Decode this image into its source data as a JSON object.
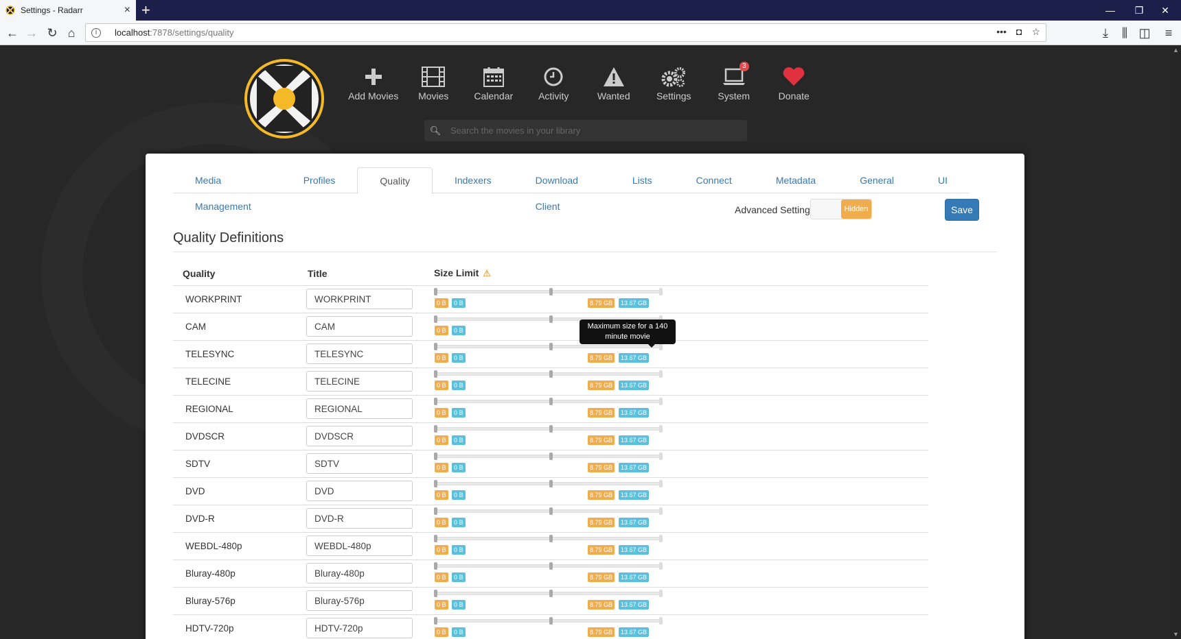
{
  "browser": {
    "tab_title": "Settings - Radarr",
    "url_host": "localhost",
    "url_rest": ":7878/settings/quality"
  },
  "nav": [
    {
      "label": "Add Movies",
      "icon": "plus-icon"
    },
    {
      "label": "Movies",
      "icon": "film-icon"
    },
    {
      "label": "Calendar",
      "icon": "calendar-icon"
    },
    {
      "label": "Activity",
      "icon": "clock-icon"
    },
    {
      "label": "Wanted",
      "icon": "warning-icon"
    },
    {
      "label": "Settings",
      "icon": "gears-icon"
    },
    {
      "label": "System",
      "icon": "laptop-icon",
      "badge": "3"
    },
    {
      "label": "Donate",
      "icon": "heart-icon"
    }
  ],
  "search": {
    "placeholder": "Search the movies in your library"
  },
  "settings_tabs": [
    "Media Management",
    "Profiles",
    "Quality",
    "Indexers",
    "Download Client",
    "Lists",
    "Connect",
    "Metadata",
    "General",
    "UI"
  ],
  "active_tab": "Quality",
  "advanced": {
    "label": "Advanced Settings",
    "state": "Hidden"
  },
  "save_label": "Save",
  "section_title": "Quality Definitions",
  "table": {
    "headers": {
      "quality": "Quality",
      "title": "Title",
      "size_limit": "Size Limit"
    },
    "size_labels": {
      "min_a": "0 B",
      "min_b": "0 B",
      "max_a": "8.79 GB",
      "max_b": "13.67 GB"
    },
    "rows": [
      {
        "quality": "WORKPRINT",
        "title": "WORKPRINT",
        "show_max": true
      },
      {
        "quality": "CAM",
        "title": "CAM",
        "show_max": false
      },
      {
        "quality": "TELESYNC",
        "title": "TELESYNC",
        "show_max": true
      },
      {
        "quality": "TELECINE",
        "title": "TELECINE",
        "show_max": true
      },
      {
        "quality": "REGIONAL",
        "title": "REGIONAL",
        "show_max": true
      },
      {
        "quality": "DVDSCR",
        "title": "DVDSCR",
        "show_max": true
      },
      {
        "quality": "SDTV",
        "title": "SDTV",
        "show_max": true
      },
      {
        "quality": "DVD",
        "title": "DVD",
        "show_max": true
      },
      {
        "quality": "DVD-R",
        "title": "DVD-R",
        "show_max": true
      },
      {
        "quality": "WEBDL-480p",
        "title": "WEBDL-480p",
        "show_max": true
      },
      {
        "quality": "Bluray-480p",
        "title": "Bluray-480p",
        "show_max": true
      },
      {
        "quality": "Bluray-576p",
        "title": "Bluray-576p",
        "show_max": true
      },
      {
        "quality": "HDTV-720p",
        "title": "HDTV-720p",
        "show_max": true
      }
    ]
  },
  "tooltip": "Maximum size for a 140 minute movie",
  "colors": {
    "accent": "#337ab7",
    "orange": "#f0ad4e",
    "cyan": "#5bc0de",
    "brand": "#f5b827"
  }
}
